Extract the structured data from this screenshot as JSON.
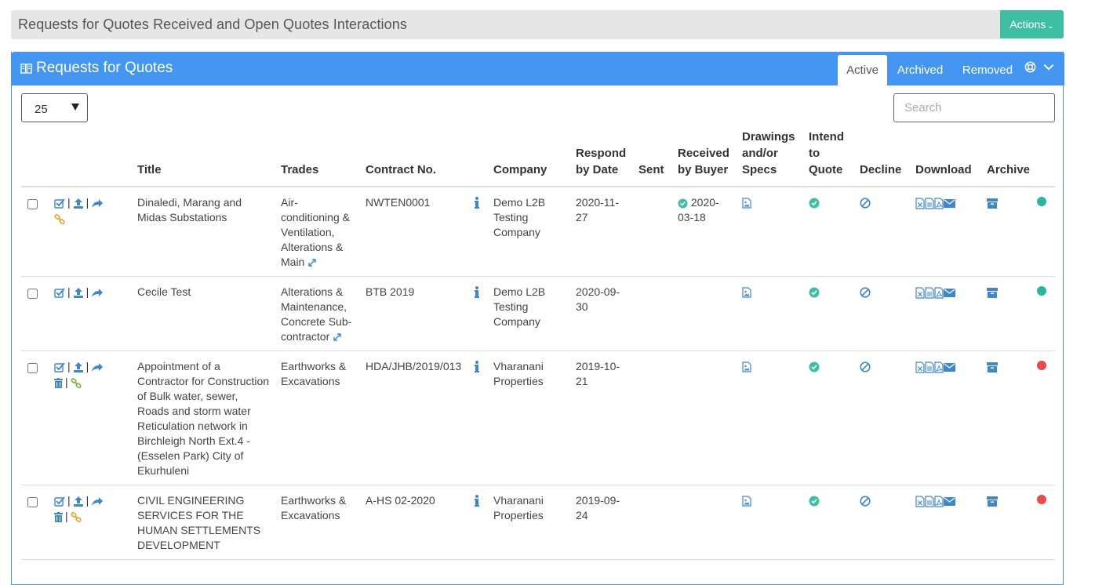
{
  "header": {
    "title": "Requests for Quotes Received and Open Quotes Interactions",
    "actions_label": "Actions"
  },
  "panel": {
    "title": "Requests for Quotes",
    "tabs": [
      {
        "label": "Active",
        "active": true
      },
      {
        "label": "Archived",
        "active": false
      },
      {
        "label": "Removed",
        "active": false
      }
    ]
  },
  "controls": {
    "page_size": "25",
    "search_placeholder": "Search"
  },
  "table": {
    "columns": {
      "title": "Title",
      "trades": "Trades",
      "contract": "Contract No.",
      "company": "Company",
      "respond_by": "Respond by Date",
      "sent": "Sent",
      "received_by_buyer": "Received by Buyer",
      "drawings": "Drawings and/or Specs",
      "intend": "Intend to Quote",
      "decline": "Decline",
      "download": "Download",
      "archive": "Archive"
    },
    "rows": [
      {
        "title": "Dinaledi, Marang and Midas Substations",
        "trades": "Air-conditioning & Ventilation, Alterations & Main",
        "trades_expand": true,
        "contract": "NWTEN0001",
        "company": "Demo L2B Testing Company",
        "respond_by": "2020-11-27",
        "sent": "",
        "received": "2020-03-18",
        "row_icons": "link",
        "status_color": "#2bb5a0"
      },
      {
        "title": "Cecile Test",
        "trades": "Alterations & Maintenance, Concrete Sub-contractor",
        "trades_expand": true,
        "contract": "BTB 2019",
        "company": "Demo L2B Testing Company",
        "respond_by": "2020-09-30",
        "sent": "",
        "received": "",
        "row_icons": "none",
        "status_color": "#2bb5a0"
      },
      {
        "title": "Appointment of a Contractor for Construction of Bulk water, sewer, Roads and storm water Reticulation network in Birchleigh North Ext.4 - (Esselen Park) City of Ekurhuleni",
        "trades": "Earthworks & Excavations",
        "trades_expand": false,
        "contract": "HDA/JHB/2019/013",
        "company": "Vharanani Properties",
        "respond_by": "2019-10-21",
        "sent": "",
        "received": "",
        "row_icons": "trash-link",
        "status_color": "#e84a4a"
      },
      {
        "title": "CIVIL ENGINEERING SERVICES FOR THE HUMAN SETTLEMENTS DEVELOPMENT",
        "trades": "Earthworks & Excavations",
        "trades_expand": false,
        "contract": "A-HS 02-2020",
        "company": "Vharanani Properties",
        "respond_by": "2019-09-24",
        "sent": "",
        "received": "",
        "row_icons": "trash-link",
        "status_color": "#e84a4a"
      }
    ]
  },
  "colors": {
    "primary_blue": "#4596f0",
    "teal": "#3ebfa3",
    "icon_blue": "#3f87c9",
    "link_orange": "#f0a030",
    "link_green": "#7ab648"
  }
}
